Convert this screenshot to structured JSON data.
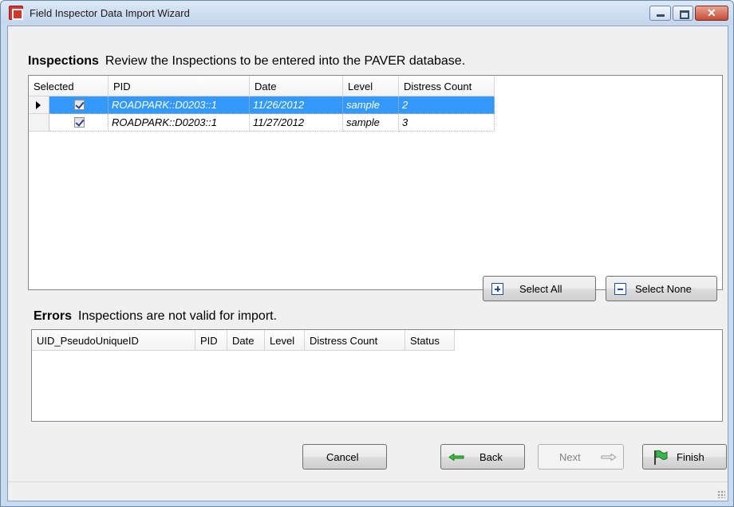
{
  "window": {
    "title": "Field Inspector Data Import Wizard"
  },
  "inspections": {
    "label": "Inspections",
    "description": "Review the Inspections to be entered into the PAVER database.",
    "columns": [
      "Selected",
      "PID",
      "Date",
      "Level",
      "Distress Count"
    ],
    "rows": [
      {
        "selected": true,
        "pid": "ROADPARK::D0203::1",
        "date": "11/26/2012",
        "level": "sample",
        "distress_count": "2"
      },
      {
        "selected": true,
        "pid": "ROADPARK::D0203::1",
        "date": "11/27/2012",
        "level": "sample",
        "distress_count": "3"
      }
    ]
  },
  "selection_buttons": {
    "select_all": "Select All",
    "select_none": "Select None"
  },
  "errors": {
    "label": "Errors",
    "description": "Inspections are not valid for import.",
    "columns": [
      "UID_PseudoUniqueID",
      "PID",
      "Date",
      "Level",
      "Distress Count",
      "Status"
    ]
  },
  "footer": {
    "cancel": "Cancel",
    "back": "Back",
    "next": "Next",
    "finish": "Finish"
  },
  "colors": {
    "selection": "#3399ff",
    "titlebar": "#c3d6ec",
    "close_button": "#c64b33"
  },
  "icons": {
    "app": "app-icon",
    "select_all": "plus-box-icon",
    "select_none": "minus-box-icon",
    "back": "arrow-left-icon",
    "next": "arrow-right-icon",
    "finish": "flag-icon",
    "current_row": "row-pointer-icon",
    "checkbox": "checkbox-checked-icon"
  }
}
